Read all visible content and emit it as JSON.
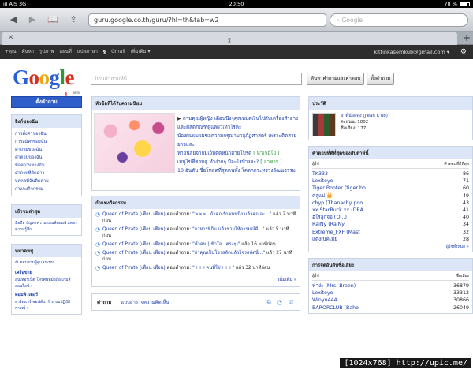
{
  "status": {
    "carrier": "ııl AIS 3G",
    "time": "20:50",
    "battery": "78 %"
  },
  "browser": {
    "url": "guru.google.co.th/guru/?hl=th&tab=w2",
    "search_placeholder": "Google",
    "tab_title": "ฐ",
    "new_tab": "+"
  },
  "gbar": {
    "items": [
      "+คุณ",
      "ค้นหา",
      "รูปภาพ",
      "แผนที่",
      "แปลภาษา",
      "ฐ",
      "Gmail",
      "เพิ่มเติม ▾"
    ],
    "account": "kittinkasemkub@gmail.com ▾"
  },
  "logo": {
    "text": [
      "G",
      "o",
      "o",
      "g",
      "l",
      "e"
    ],
    "sub": "ฐ",
    "beta": "BETA"
  },
  "search": {
    "placeholder": "ป้อนคำถามที่นี่",
    "btn_search": "ค้นหาคำถามและคำตอบ",
    "btn_ask": "ตั้งคำถาม"
  },
  "left": {
    "ask_button": "ตั้งคำถาม",
    "links_title": "ลิงก์ของฉัน",
    "links": [
      "การตั้งค่าของฉัน",
      "การสมัครของฉัน",
      "คำถามของฉัน",
      "คำตอบของฉัน",
      "ข้อความของฉัน",
      "คำถามที่ติดดาว",
      "บุคคลที่ฉันติดตาม",
      "กำแพงกิจกรรม"
    ],
    "latest_title": "เข้าชมล่าสุด",
    "latest_text": "มือถือ   ปัญหาความ   เกมส์คอมพิวเตอร์ ความรู้สึก",
    "cats_title": "หมวดหมู่",
    "cats_all": "ชอบตามผู้ดูแลระบบ",
    "groups": [
      {
        "name": "เครือข่าย",
        "sub": "อินเทอร์เน็ต  โทรศัพท์มือถือ เกมส์ออนไลน์ »"
      },
      {
        "name": "คอมพิวเตอร์",
        "sub": "ฮาร์ดแวร์  ซอฟต์แวร์ ระบบปฏิบัติการณ์ »"
      }
    ]
  },
  "center": {
    "popular_title": "หัวข้อที่ได้รับความนิยม",
    "popular": [
      {
        "text": "ถามคุณผู้หญิง เดือนนึงๆคุณหมดเงินไปกับเครื่องสำอางและผลิตภัณฑ์ดูแลผิวเท่าไรคะ",
        "tag": ""
      },
      {
        "text": "น้องผมผมผมขอความกรุณาบาสุภัฏศาสตร์ เพราะติดสายยาวและ",
        "tag": ""
      },
      {
        "text": "หายนิสัยจากมีเว็บติดหน้าสายโปรด",
        "tag": "[ หาเจอ้โย ]"
      },
      {
        "text": "เมนูไข่ที่ชอบคู่ ทำง่ายๆ มีอะไรบ้างคะ?",
        "tag": "[ อาหาร ]"
      },
      {
        "text": "10 อันดับ ชื่อโหลดที่สุดคนทั้ง โคลกกระทรวงวัฒนธรรม",
        "tag": ""
      }
    ],
    "activity_title": "กำแพงกิจกรรม",
    "activity": [
      {
        "who": "Queen of Pirate (เพื่อน เพื่อน)",
        "verb": " ตอบคำถาม: ",
        "q": "\">>>...ถ้าคุณรักคนหนึ่ง แล้วคุณจะ...\"",
        "time": " แล้ว 2 นาทีก่อน"
      },
      {
        "who": "Queen of Pirate (เพื่อน เพื่อน)",
        "verb": " ตอบคำถาม: ",
        "q": "\"อาหารที่กิน แล้วช่วยให้อารมณ์ดี...\"",
        "time": " แล้ว 5 นาทีก่อน"
      },
      {
        "who": "Queen of Pirate (เพื่อน เพื่อน)",
        "verb": " ตอบคำถาม: ",
        "q": "\"คำคม (เข้าใจ...ตรงๆ)\"",
        "time": " แล้ว 16 นาทีก่อน"
      },
      {
        "who": "Queen of Pirate (เพื่อน เพื่อน)",
        "verb": " ตอบคำถาม: ",
        "q": "\"ถ้าคุณเป็นโจรสลัดแล้วโจรสลัดนี่...\"",
        "time": " แล้ว 27 นาทีก่อน"
      },
      {
        "who": "Queen of Pirate (เพื่อน เพื่อน)",
        "verb": " ตอบคำถาม: ",
        "q": "\"+++คนที่ใช่+++\"",
        "time": " แล้ว 32 นาทีก่อน"
      }
    ],
    "more_activity": "เพิ่มเติม »",
    "tab_questions": "คำถาม",
    "tab_opinions": "แบบสำรวจความคิดเห็น"
  },
  "right": {
    "profile_title": "ประวัติ",
    "profile": {
      "name": "อาตี๋น้อยคุง (J'ean K'ub)",
      "points": "คะแนน: 1802",
      "reputation": "ชื่อเสียง: 177"
    },
    "top_answer_title": "คำตอบที่ดีที่สุดของสัปดาห์นี้",
    "top_answer_head": [
      "ผู้ใช้",
      "คำตอบที่ดีที่สุด"
    ],
    "top_answer": [
      {
        "n": "TK333",
        "v": "86"
      },
      {
        "n": "Lexitoyo",
        "v": "71"
      },
      {
        "n": "Tiger Booter (tiger bo",
        "v": "60"
      },
      {
        "n": "คลูแม่ 👑",
        "v": "49"
      },
      {
        "n": "chyp (Thanachy poo",
        "v": "43"
      },
      {
        "n": "xx StarBuck xx (DRA",
        "v": "41"
      },
      {
        "n": "ฮีโร่ลูกจ๋อ (Ὁ...)",
        "v": "40"
      },
      {
        "n": "RaiNy (RaiNy",
        "v": "34"
      },
      {
        "n": "Extreme_FXF (Mast",
        "v": "32"
      },
      {
        "n": "แต่งเนคเมีย",
        "v": "28"
      }
    ],
    "top_answer_more": "ผู้ใช้ทั้งหมด »",
    "rep_title": "การจัดอันดับชื่อเสียง",
    "rep_head": [
      "ผู้ใช้",
      "ชื่อเสียง"
    ],
    "rep": [
      {
        "n": "ฟ่าง่ะ (Mrs. Breen)",
        "v": "36879"
      },
      {
        "n": "Lexitoyo",
        "v": "33312"
      },
      {
        "n": "Winyu444",
        "v": "30866"
      },
      {
        "n": "BARORCLUB (Baho",
        "v": "26049"
      }
    ]
  },
  "watermark": "[1024x768] http://upic.me/"
}
